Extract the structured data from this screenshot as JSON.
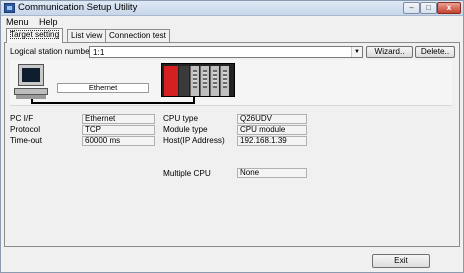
{
  "window": {
    "title": "Communication Setup Utility",
    "min": "–",
    "max": "□",
    "close": "x"
  },
  "menu": [
    "Menu",
    "Help"
  ],
  "tabs": [
    "Target setting",
    "List view",
    "Connection test"
  ],
  "station": {
    "label": "Logical station number",
    "value": "1:1",
    "wizard": "Wizard..",
    "delete": "Delete.."
  },
  "diagram": {
    "link_label": "Ethernet"
  },
  "fields": {
    "pc_if": {
      "label": "PC I/F",
      "value": "Ethernet"
    },
    "protocol": {
      "label": "Protocol",
      "value": "TCP"
    },
    "timeout": {
      "label": "Time-out",
      "value": "60000 ms"
    },
    "cpu_type": {
      "label": "CPU type",
      "value": "Q26UDV"
    },
    "module_type": {
      "label": "Module type",
      "value": "CPU module"
    },
    "host": {
      "label": "Host(IP Address)",
      "value": "192.168.1.39"
    },
    "multiple_cpu": {
      "label": "Multiple CPU",
      "value": "None"
    }
  },
  "exit_label": "Exit",
  "colors": {
    "psu": "#d42020",
    "title_bar": "#c7d6ea"
  }
}
